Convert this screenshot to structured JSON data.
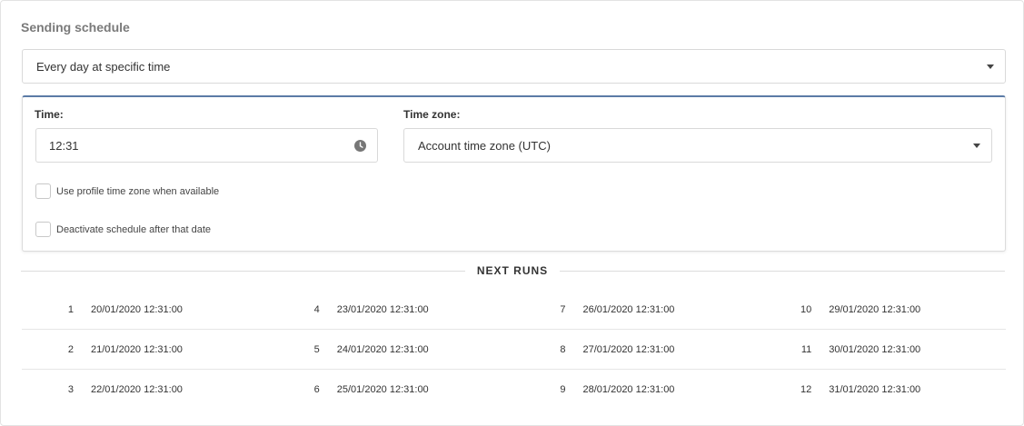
{
  "section": {
    "title": "Sending schedule"
  },
  "frequency": {
    "value": "Every day at specific time"
  },
  "time": {
    "label": "Time:",
    "value": "12:31"
  },
  "timezone": {
    "label": "Time zone:",
    "value": "Account time zone (UTC)"
  },
  "options": {
    "profile_tz": "Use profile time zone when available",
    "deactivate": "Deactivate schedule after that date"
  },
  "next_runs": {
    "title": "NEXT RUNS",
    "items": [
      {
        "n": "1",
        "date": "20/01/2020 12:31:00"
      },
      {
        "n": "2",
        "date": "21/01/2020 12:31:00"
      },
      {
        "n": "3",
        "date": "22/01/2020 12:31:00"
      },
      {
        "n": "4",
        "date": "23/01/2020 12:31:00"
      },
      {
        "n": "5",
        "date": "24/01/2020 12:31:00"
      },
      {
        "n": "6",
        "date": "25/01/2020 12:31:00"
      },
      {
        "n": "7",
        "date": "26/01/2020 12:31:00"
      },
      {
        "n": "8",
        "date": "27/01/2020 12:31:00"
      },
      {
        "n": "9",
        "date": "28/01/2020 12:31:00"
      },
      {
        "n": "10",
        "date": "29/01/2020 12:31:00"
      },
      {
        "n": "11",
        "date": "30/01/2020 12:31:00"
      },
      {
        "n": "12",
        "date": "31/01/2020 12:31:00"
      }
    ]
  },
  "colors": {
    "accent": "#5b7ba6",
    "border": "#d9d9d9",
    "title_gray": "#7a7a7a"
  },
  "icons": {
    "time": "clock-icon",
    "dropdown": "caret-down-icon"
  }
}
